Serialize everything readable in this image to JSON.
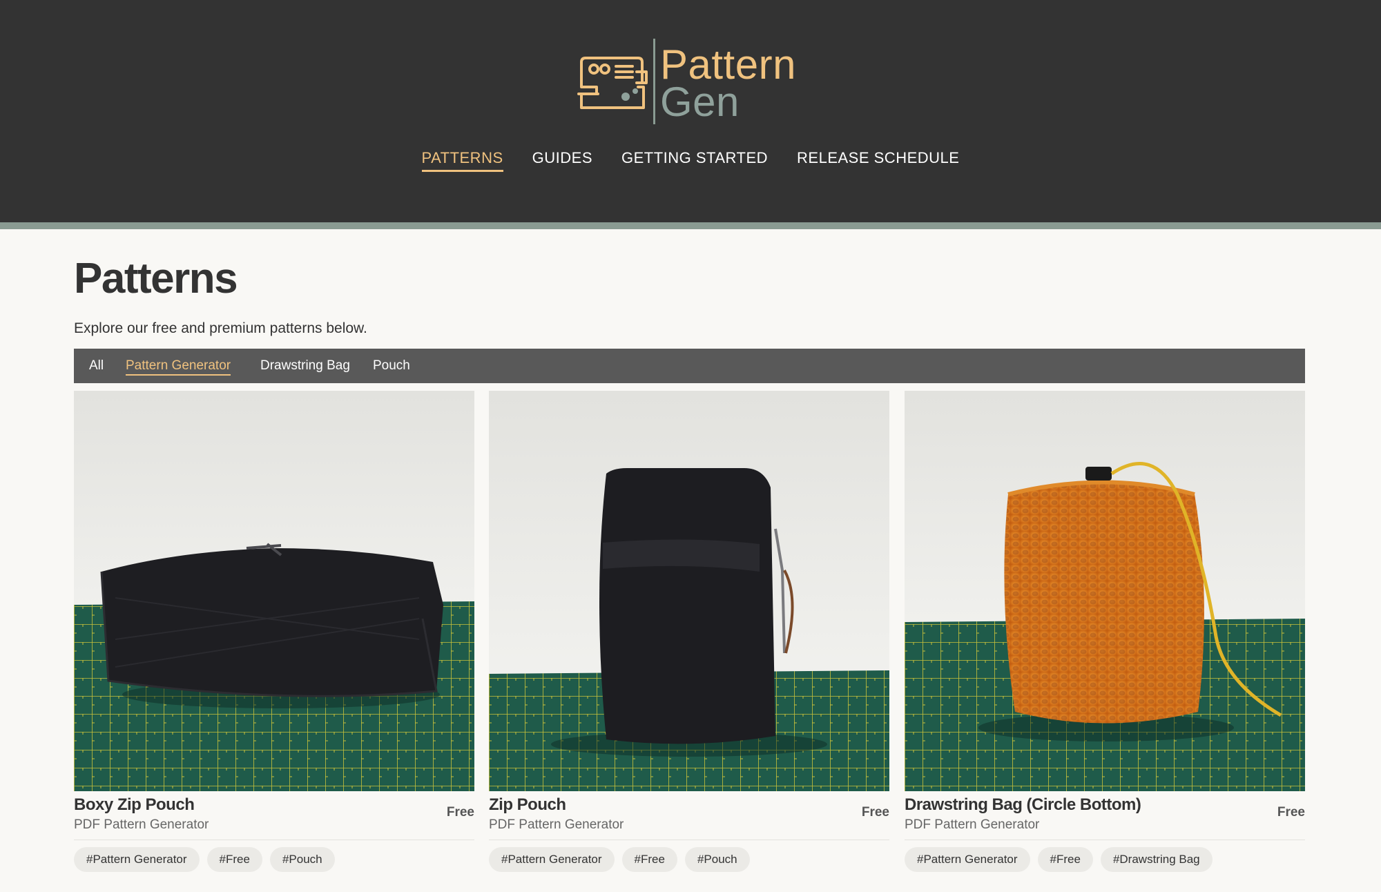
{
  "brand": {
    "word1": "Pattern",
    "word2": "Gen",
    "logo_icon": "sewing-machine-icon",
    "accent": "#f0c27f",
    "secondary": "#8fa19b",
    "header_bg": "#333333"
  },
  "nav": {
    "items": [
      {
        "label": "PATTERNS",
        "active": true
      },
      {
        "label": "GUIDES",
        "active": false
      },
      {
        "label": "GETTING STARTED",
        "active": false
      },
      {
        "label": "RELEASE SCHEDULE",
        "active": false
      }
    ]
  },
  "page": {
    "title": "Patterns",
    "description": "Explore our free and premium patterns below."
  },
  "filters": {
    "items": [
      {
        "label": "All",
        "active": false
      },
      {
        "label": "Pattern Generator",
        "active": true
      },
      {
        "label": "Drawstring Bag",
        "active": false
      },
      {
        "label": "Pouch",
        "active": false
      }
    ]
  },
  "products": [
    {
      "title": "Boxy Zip Pouch",
      "price": "Free",
      "subtitle": "PDF Pattern Generator",
      "image": "black-boxy-zip-pouch-photo",
      "tags": [
        "#Pattern Generator",
        "#Free",
        "#Pouch"
      ]
    },
    {
      "title": "Zip Pouch",
      "price": "Free",
      "subtitle": "PDF Pattern Generator",
      "image": "black-zip-pouch-photo",
      "tags": [
        "#Pattern Generator",
        "#Free",
        "#Pouch"
      ]
    },
    {
      "title": "Drawstring Bag (Circle Bottom)",
      "price": "Free",
      "subtitle": "PDF Pattern Generator",
      "image": "orange-mesh-drawstring-bag-photo",
      "tags": [
        "#Pattern Generator",
        "#Free",
        "#Drawstring Bag"
      ]
    }
  ]
}
